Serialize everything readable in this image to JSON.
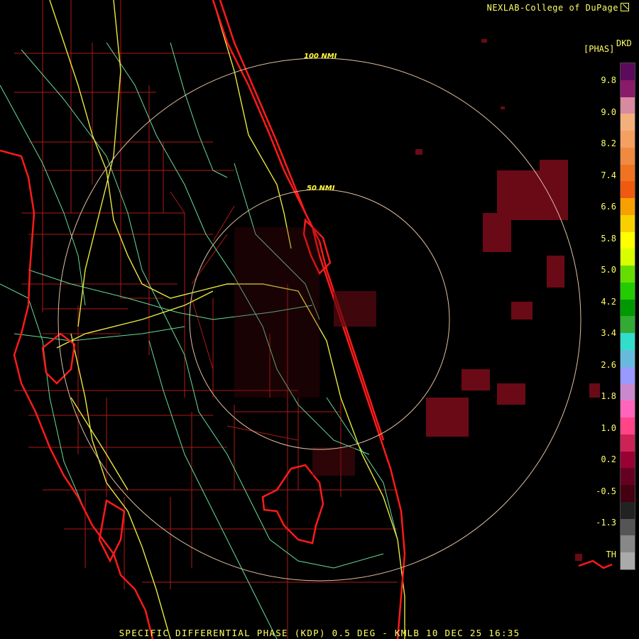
{
  "header": {
    "credit": "NEXLAB-College of DuPage"
  },
  "legend": {
    "unit": "[PHAS]",
    "code": "DKD",
    "ticks": [
      "9.8",
      "9.0",
      "8.2",
      "7.4",
      "6.6",
      "5.8",
      "5.0",
      "4.2",
      "3.4",
      "2.6",
      "1.8",
      "1.0",
      "0.2",
      "-0.5",
      "-1.3",
      "TH"
    ],
    "colors": [
      "#5c0a5c",
      "#8a1a6a",
      "#d88aa0",
      "#f4b07a",
      "#f4a060",
      "#f08a40",
      "#f07420",
      "#f05a10",
      "#f8a000",
      "#f8d000",
      "#ffff00",
      "#d8ff00",
      "#66dd00",
      "#22cc00",
      "#009900",
      "#33aa33",
      "#33ddcc",
      "#66bbdd",
      "#9999ff",
      "#cc88cc",
      "#ff66bb",
      "#ff4488",
      "#cc2255",
      "#990033",
      "#660022",
      "#440011",
      "#222222",
      "#555555",
      "#888888",
      "#aaaaaa"
    ]
  },
  "map": {
    "range_rings": [
      "50 NMI",
      "100 NMI"
    ],
    "colors": {
      "county_lines": "#b01818",
      "coastline": "#ff1a1a",
      "highways": "#e8e840",
      "roads": "#66dd99",
      "rings": "#e0c0a0",
      "echo": "#6a0a16"
    }
  },
  "footer": {
    "caption": "SPECIFIC DIFFERENTIAL PHASE (KDP) 0.5 DEG - KMLB 10 DEC 25 16:35"
  }
}
